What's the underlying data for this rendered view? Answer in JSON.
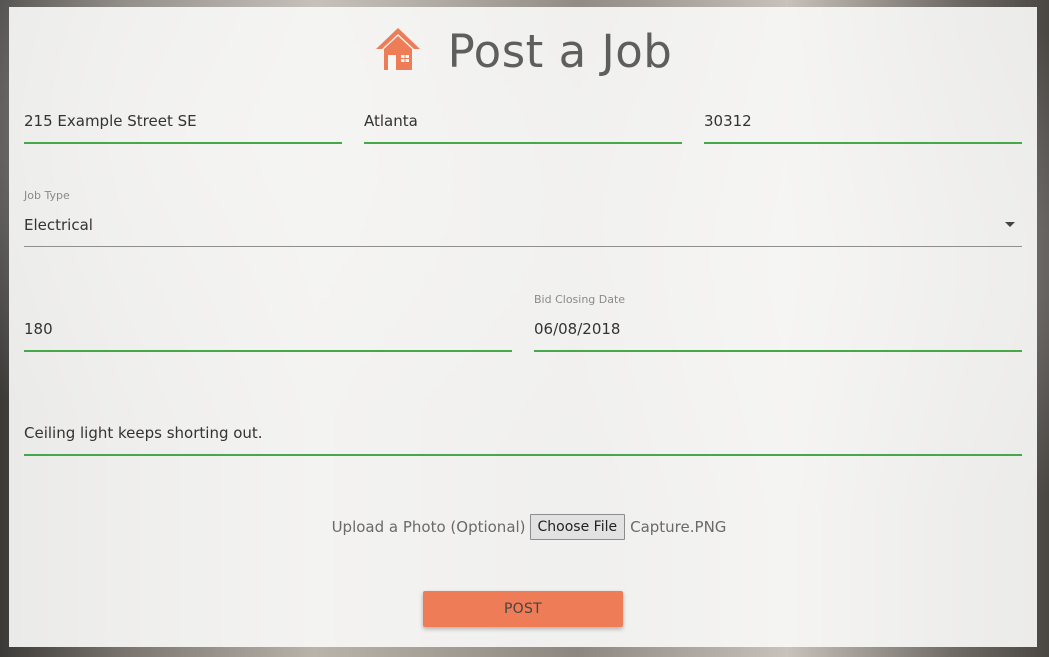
{
  "page": {
    "title": "Post a Job",
    "accent_color": "#ee7d57",
    "field_underline_color": "#46a84a",
    "icon": "home-icon"
  },
  "address": {
    "street": "215 Example Street SE",
    "city": "Atlanta",
    "zip": "30312"
  },
  "job_type": {
    "label": "Job Type",
    "selected": "Electrical"
  },
  "budget": {
    "value": "180"
  },
  "bid_closing": {
    "label": "Bid Closing Date",
    "value": "06/08/2018"
  },
  "description": {
    "value": "Ceiling light keeps shorting out."
  },
  "upload": {
    "label": "Upload a Photo (Optional)",
    "button_label": "Choose File",
    "file_name": "Capture.PNG"
  },
  "submit": {
    "label": "POST"
  }
}
